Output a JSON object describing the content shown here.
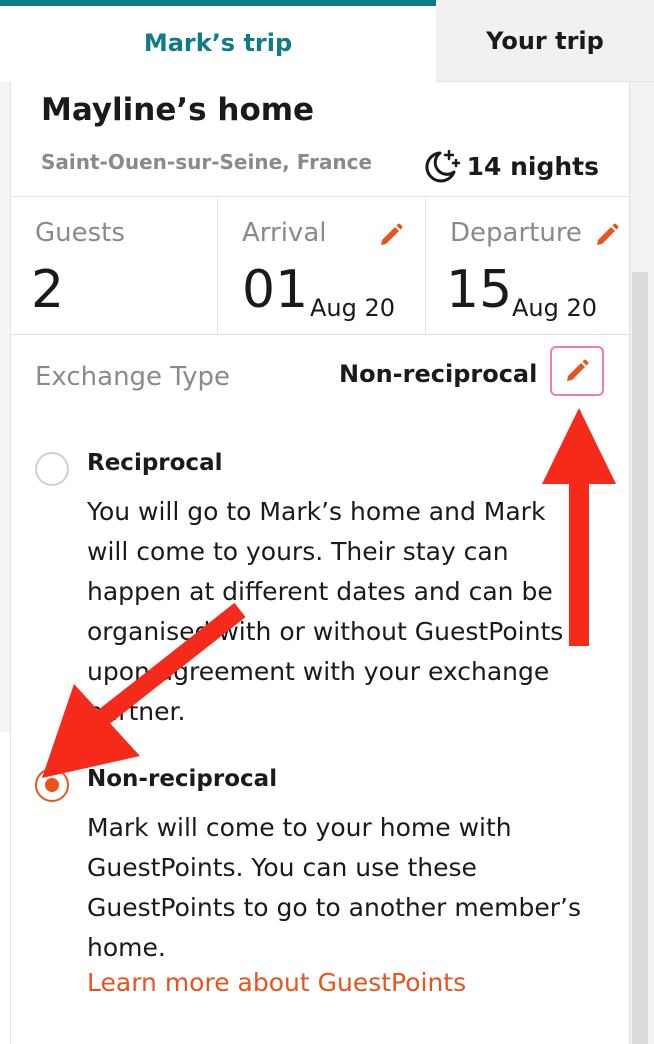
{
  "tabs": {
    "mark_trip": "Mark’s trip",
    "your_trip": "Your trip"
  },
  "home": {
    "title": "Mayline’s home",
    "location": "Saint-Ouen-sur-Seine, France",
    "nights": "14 nights"
  },
  "stats": {
    "guests_label": "Guests",
    "guests_value": "2",
    "arrival_label": "Arrival",
    "arrival_day": "01",
    "arrival_month": "Aug 20",
    "departure_label": "Departure",
    "departure_day": "15",
    "departure_month": "Aug 20"
  },
  "exchange": {
    "label": "Exchange Type",
    "value": "Non-reciprocal"
  },
  "options": {
    "reciprocal": {
      "title": "Reciprocal",
      "description": "You will go to Mark’s home and Mark will come to yours. Their stay can happen at different dates and can be organised with or without GuestPoints upon agreement with your exchange partner.",
      "selected": false
    },
    "non_reciprocal": {
      "title": "Non-reciprocal",
      "description": "Mark will come to your home with GuestPoints. You can use these GuestPoints to go to another member’s home.",
      "selected": true
    }
  },
  "learn_more": "Learn more about GuestPoints",
  "colors": {
    "teal": "#0e7c86",
    "orange": "#e8541c",
    "pink_border": "#ec7fb0",
    "annotation_red": "#f52a1b"
  },
  "icons": [
    "moon-stars-icon",
    "pencil-icon"
  ]
}
